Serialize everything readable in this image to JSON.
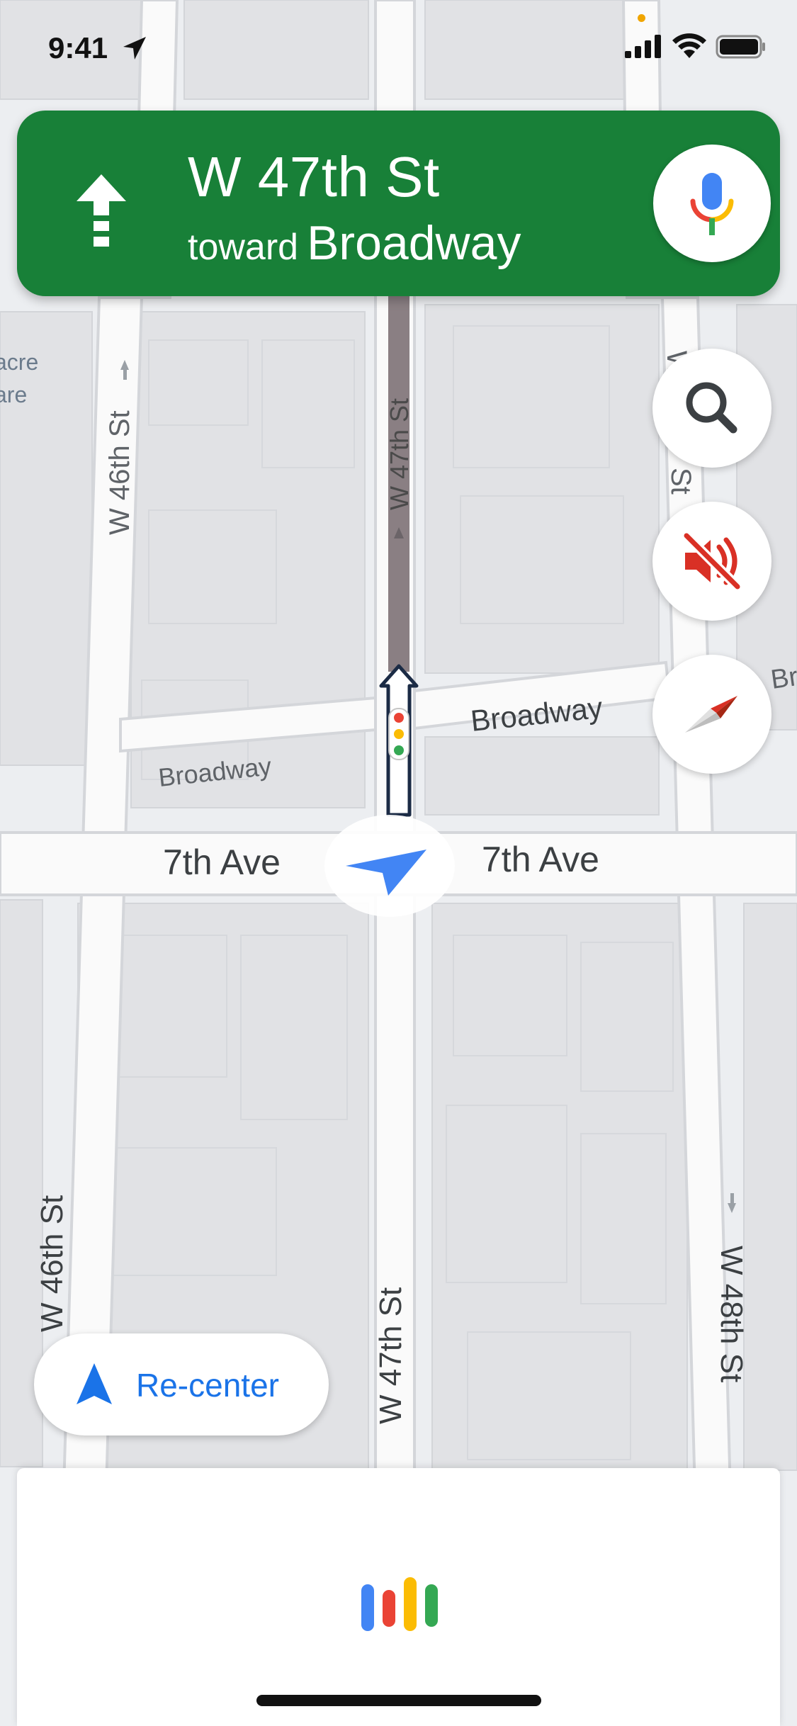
{
  "status_bar": {
    "time": "9:41"
  },
  "navigation": {
    "street": "W 47th St",
    "toward_label": "toward",
    "toward_destination": "Broadway",
    "banner_color": "#188038",
    "turn_icon": "straight-arrow-icon"
  },
  "map_labels": {
    "w46_top": "W 46th St",
    "w46_bottom": "W 46th St",
    "w47_route": "W 47th St",
    "w47_bottom": "W 47th St",
    "w48_right": "W 48th St",
    "w48_top_partial": "W",
    "st_fragment": "St",
    "broadway_right": "Broadway",
    "broadway_left": "Broadway",
    "broadway_edge": "Bru",
    "seventh_left": "7th Ave",
    "seventh_right": "7th Ave",
    "acre_fragment": "acre",
    "are_fragment": "are"
  },
  "controls": {
    "search_icon": "search-icon",
    "mute_icon": "mute-icon",
    "compass_icon": "compass-icon",
    "mic_icon": "mic-icon",
    "recenter_label": "Re-center"
  },
  "colors": {
    "route": "#8a7f83",
    "accent_blue": "#1a73e8",
    "map_bg": "#eceef1",
    "buildings": "#e2e3e6"
  }
}
